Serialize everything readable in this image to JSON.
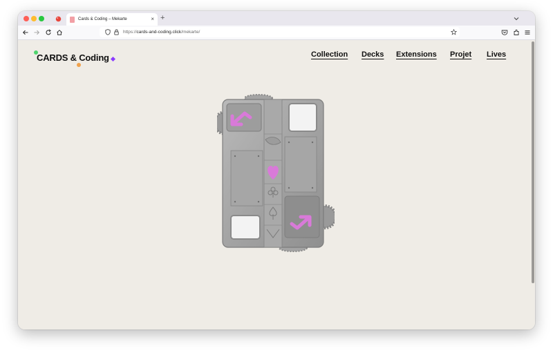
{
  "browser": {
    "tab_title": "Cards & Coding – Mekarte",
    "tab_close": "×",
    "new_tab": "+",
    "url_scheme": "https://",
    "url_host": "cards-and-coding.click",
    "url_path": "/mekarte/",
    "icons": {
      "back": "back-arrow-icon",
      "forward": "forward-arrow-icon",
      "reload": "reload-icon",
      "home": "home-icon",
      "shield": "tracking-protection-icon",
      "lock": "lock-icon",
      "bookmark": "star-icon",
      "pocket": "pocket-icon",
      "extensions": "extensions-icon",
      "menu": "hamburger-menu-icon",
      "tablist": "chevron-down-icon"
    }
  },
  "site": {
    "logo_text": "CARDS & Coding",
    "nav": [
      "Collection",
      "Decks",
      "Extensions",
      "Projet",
      "Lives"
    ]
  },
  "colors": {
    "page_bg": "#efece6",
    "model_grey": "#a2a2a2",
    "accent_pink": "#d97ad9",
    "logo_green": "#4fd46d",
    "logo_orange": "#f0a24d",
    "logo_purple": "#8b3bff"
  },
  "model": {
    "symbols": [
      "arrow-upleft",
      "heart",
      "club",
      "spade",
      "diamond",
      "arrow-downright"
    ]
  }
}
